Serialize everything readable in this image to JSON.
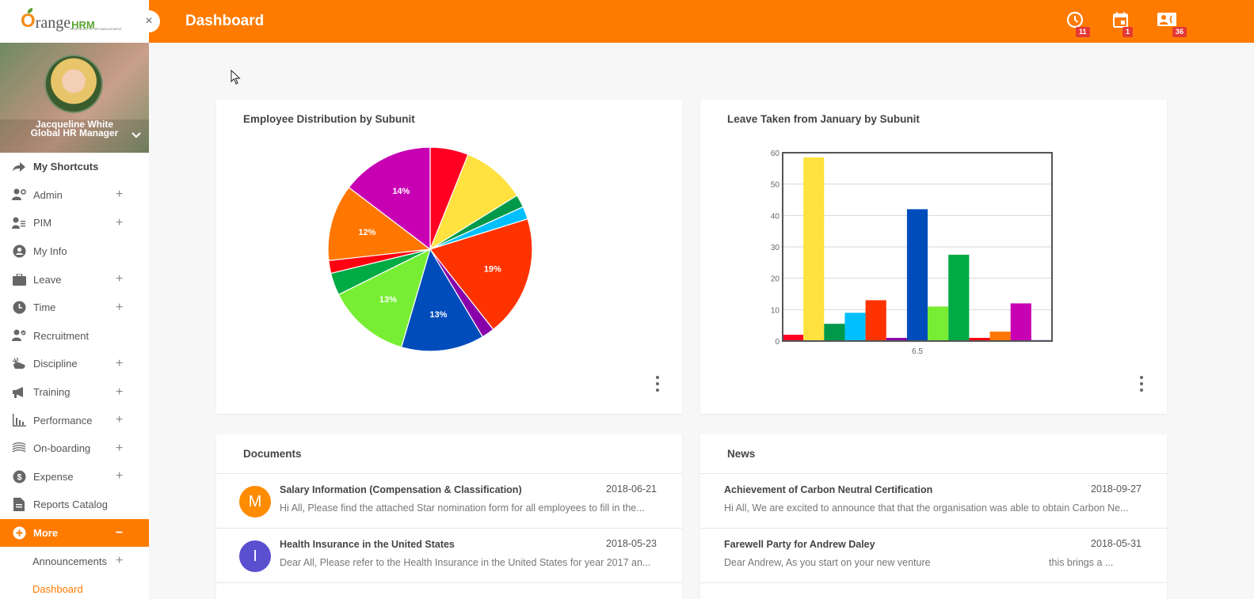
{
  "app": {
    "logo_text_o": "O",
    "logo_text_range": "range",
    "logo_text_hrm": "HRM",
    "logo_tagline": "NEW LEVEL OF HR MANAGEMENT",
    "close_glyph": "×",
    "brand_color": "#ff7b00"
  },
  "profile": {
    "name": "Jacqueline White",
    "role": "Global HR Manager",
    "toggle_glyph": "⌄"
  },
  "sidebar": {
    "items": [
      {
        "label": "My Shortcuts",
        "icon": "share-arrow-icon",
        "expand": ""
      },
      {
        "label": "Admin",
        "icon": "user-gear-icon",
        "expand": "+"
      },
      {
        "label": "PIM",
        "icon": "user-list-icon",
        "expand": "+"
      },
      {
        "label": "My Info",
        "icon": "user-circle-icon",
        "expand": ""
      },
      {
        "label": "Leave",
        "icon": "briefcase-icon",
        "expand": "+"
      },
      {
        "label": "Time",
        "icon": "clock-icon",
        "expand": "+"
      },
      {
        "label": "Recruitment",
        "icon": "user-check-icon",
        "expand": ""
      },
      {
        "label": "Discipline",
        "icon": "discipline-icon",
        "expand": "+"
      },
      {
        "label": "Training",
        "icon": "megaphone-icon",
        "expand": "+"
      },
      {
        "label": "Performance",
        "icon": "bar-chart-icon",
        "expand": "+"
      },
      {
        "label": "On-boarding",
        "icon": "stack-icon",
        "expand": "+"
      },
      {
        "label": "Expense",
        "icon": "dollar-circle-icon",
        "expand": "+"
      },
      {
        "label": "Reports Catalog",
        "icon": "document-icon",
        "expand": ""
      },
      {
        "label": "More",
        "icon": "plus-circle-icon",
        "expand": "−"
      },
      {
        "label": "Announcements",
        "icon": "",
        "expand": "+"
      },
      {
        "label": "Dashboard",
        "icon": "",
        "expand": ""
      }
    ]
  },
  "header": {
    "title": "Dashboard",
    "notifications": [
      {
        "icon": "clock-icon",
        "count": "11"
      },
      {
        "icon": "calendar-icon",
        "count": "1"
      },
      {
        "icon": "contacts-icon",
        "count": "36"
      }
    ]
  },
  "cards": {
    "pie_title": "Employee Distribution by Subunit",
    "bar_title": "Leave Taken from January by Subunit",
    "documents_title": "Documents",
    "news_title": "News"
  },
  "documents": [
    {
      "avatar_letter": "M",
      "avatar_color": "#ff8c00",
      "title": "Salary Information (Compensation & Classification)",
      "date": "2018-06-21",
      "desc": "Hi All, Please find the attached Star nomination form for all employees to fill in the..."
    },
    {
      "avatar_letter": "I",
      "avatar_color": "#5a4fcf",
      "title": "Health Insurance in the United States",
      "date": "2018-05-23",
      "desc": "Dear All, Please refer to the Health Insurance in the United States for year 2017 an..."
    }
  ],
  "news": [
    {
      "title": "Achievement of Carbon Neutral Certification",
      "date": "2018-09-27",
      "desc": "Hi All, We are excited to announce that that the organisation was able to obtain Carbon Ne..."
    },
    {
      "title": "Farewell Party for Andrew Daley",
      "date": "2018-05-31",
      "desc": "Dear Andrew, As you start on your new venture",
      "desc_tail": "this brings a ..."
    }
  ],
  "chart_data": [
    {
      "type": "pie",
      "title": "Employee Distribution by Subunit",
      "slices": [
        {
          "label": "",
          "value": 6,
          "color": "#ff0022",
          "show_label": false
        },
        {
          "label": "",
          "value": 10,
          "color": "#ffe23f",
          "show_label": false
        },
        {
          "label": "",
          "value": 2,
          "color": "#00994a",
          "show_label": false
        },
        {
          "label": "",
          "value": 2,
          "color": "#00bfff",
          "show_label": false
        },
        {
          "label": "19%",
          "value": 19,
          "color": "#ff3300",
          "show_label": true
        },
        {
          "label": "",
          "value": 2,
          "color": "#8800aa",
          "show_label": false
        },
        {
          "label": "13%",
          "value": 13,
          "color": "#004cbb",
          "show_label": true
        },
        {
          "label": "13%",
          "value": 13,
          "color": "#77ee33",
          "show_label": true
        },
        {
          "label": "",
          "value": 3.5,
          "color": "#00aa44",
          "show_label": false
        },
        {
          "label": "",
          "value": 2,
          "color": "#ff0011",
          "show_label": false
        },
        {
          "label": "12%",
          "value": 12,
          "color": "#ff7700",
          "show_label": true
        },
        {
          "label": "14%",
          "value": 14.5,
          "color": "#c800b4",
          "show_label": true
        }
      ]
    },
    {
      "type": "bar",
      "title": "Leave Taken from January by Subunit",
      "categories": [
        "6.5"
      ],
      "xlabel": "",
      "ylabel": "",
      "ylim": [
        0,
        60
      ],
      "yticks": [
        0,
        10,
        20,
        30,
        40,
        50,
        60
      ],
      "grid": true,
      "series": [
        {
          "value": 2,
          "color": "#ff0022"
        },
        {
          "value": 58.5,
          "color": "#ffe23f"
        },
        {
          "value": 5.5,
          "color": "#00994a"
        },
        {
          "value": 9,
          "color": "#00bfff"
        },
        {
          "value": 13,
          "color": "#ff3300"
        },
        {
          "value": 1,
          "color": "#8800aa"
        },
        {
          "value": 42,
          "color": "#004cbb"
        },
        {
          "value": 11,
          "color": "#77ee33"
        },
        {
          "value": 27.5,
          "color": "#00aa44"
        },
        {
          "value": 1,
          "color": "#ff0011"
        },
        {
          "value": 3,
          "color": "#ff7700"
        },
        {
          "value": 12,
          "color": "#c800b4"
        },
        {
          "value": 0.3,
          "color": "#2233aa"
        }
      ]
    }
  ]
}
